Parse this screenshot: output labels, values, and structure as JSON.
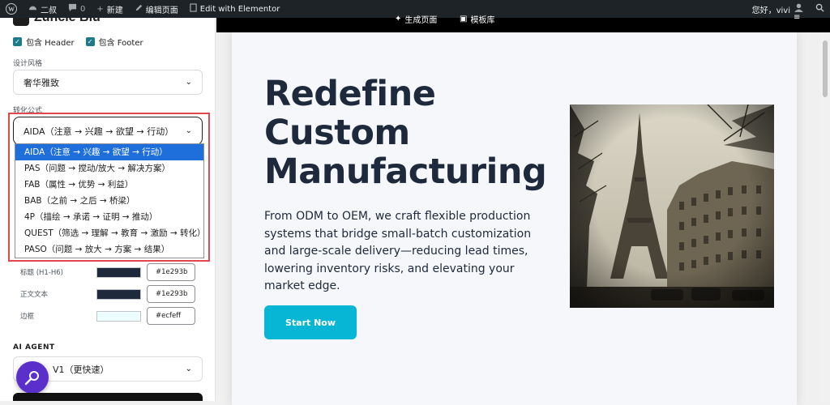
{
  "admin_bar": {
    "site_name": "二叔",
    "comments_count": "0",
    "new_label": "新建",
    "edit_page_label": "编辑页面",
    "elementor_label": "Edit with Elementor",
    "greeting": "您好，vivi"
  },
  "sidebar": {
    "brand": "Zuncle Biu",
    "include_header": "包含 Header",
    "include_footer": "包含 Footer",
    "design_style_label": "设计风格",
    "design_style_value": "奢华雅致",
    "formula_label": "转化公式",
    "formula_value": "AIDA（注意 → 兴趣 → 欲望 → 行动）",
    "formula_options": [
      "AIDA（注意 → 兴趣 → 欲望 → 行动）",
      "PAS（问题 → 搅动/放大 → 解决方案）",
      "FAB（属性 → 优势 → 利益）",
      "BAB（之前 → 之后 → 桥梁）",
      "4P（描绘 → 承诺 → 证明 → 推动）",
      "QUEST（筛选 → 理解 → 教育 → 激励 → 转化）",
      "PASO（问题 → 放大 → 方案 → 结果）"
    ],
    "colors": [
      {
        "label": "标题 (H1-H6)",
        "hex": "#1e293b"
      },
      {
        "label": "正文文本",
        "hex": "#1e293b"
      },
      {
        "label": "边框",
        "hex": "#ecfeff"
      }
    ],
    "agent_label": "AI AGENT",
    "agent_value": "V1（更快速）"
  },
  "preview": {
    "nav_items": [
      "生成页面",
      "模板库"
    ],
    "headline_lines": [
      "Redefine",
      "Custom",
      "Manufacturing"
    ],
    "paragraph": "From ODM to OEM, we craft flexible production systems that bridge small-batch customization and large-scale delivery—reducing lead times, lowering inventory risks, and elevating your market edge.",
    "cta_label": "Start Now"
  },
  "colors": {
    "admin_bar_bg": "#1d2327",
    "cta_bg": "#06b6d4",
    "heading_text": "#1e293b",
    "highlight_box": "#e0484e",
    "selected_option": "#1e6fdc",
    "agent_button": "#5b2fc9"
  }
}
